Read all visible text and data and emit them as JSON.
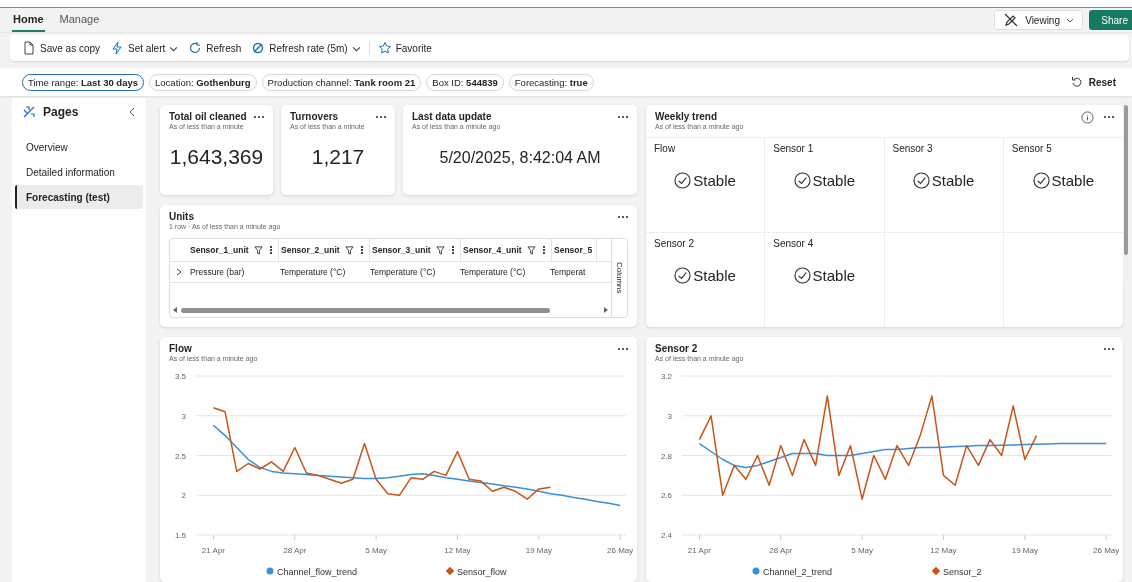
{
  "tabs": [
    {
      "label": "Home",
      "selected": true
    },
    {
      "label": "Manage",
      "selected": false
    }
  ],
  "view_mode": {
    "label": "Viewing"
  },
  "share_button": {
    "label": "Share"
  },
  "toolbar": [
    {
      "label": "Save as copy",
      "kind": "page",
      "dropdown": false,
      "separator_before": false
    },
    {
      "label": "Set alert",
      "kind": "bolt",
      "dropdown": true,
      "separator_before": false
    },
    {
      "label": "Refresh",
      "kind": "refresh",
      "dropdown": false,
      "separator_before": false
    },
    {
      "label": "Refresh rate (5m)",
      "kind": "rate",
      "dropdown": true,
      "separator_before": false
    },
    {
      "label": "Favorite",
      "kind": "star",
      "dropdown": false,
      "separator_before": true
    }
  ],
  "filters": [
    {
      "name": "Time range:",
      "value": "Last 30 days",
      "selected": true
    },
    {
      "name": "Location:",
      "value": "Gothenburg",
      "selected": false
    },
    {
      "name": "Production channel:",
      "value": "Tank room 21",
      "selected": false
    },
    {
      "name": "Box ID:",
      "value": "544839",
      "selected": false
    },
    {
      "name": "Forecasting:",
      "value": "true",
      "selected": false
    }
  ],
  "reset_button": {
    "label": "Reset"
  },
  "sidebar": {
    "title": "Pages",
    "items": [
      {
        "label": "Overview",
        "selected": false
      },
      {
        "label": "Detailed information",
        "selected": false
      },
      {
        "label": "Forecasting (test)",
        "selected": true
      }
    ]
  },
  "kpis": [
    {
      "title": "Total oil cleaned",
      "subtitle": "As of less than a minute",
      "value": "1,643,369"
    },
    {
      "title": "Turnovers",
      "subtitle": "As of less than a minute",
      "value": "1,217"
    },
    {
      "title": "Last data update",
      "subtitle": "As of less than a minute ago",
      "value": "5/20/2025, 8:42:04 AM"
    }
  ],
  "units": {
    "title": "Units",
    "subtitle": "1 row · As of less than a minute ago",
    "columns": [
      "Sensor_1_unit",
      "Sensor_2_unit",
      "Sensor_3_unit",
      "Sensor_4_unit",
      "Sensor_5"
    ],
    "rows": [
      {
        "cells": [
          "Pressure (bar)",
          "Temperature (°C)",
          "Temperature (°C)",
          "Temperature (°C)",
          "Temperat"
        ]
      }
    ],
    "side_panel": "Columns"
  },
  "weekly_trend": {
    "title": "Weekly trend",
    "subtitle": "As of less than a minute ago",
    "tiles": [
      {
        "label": "Flow",
        "status": "Stable",
        "kind": "stable"
      },
      {
        "label": "Sensor 1",
        "status": "Stable",
        "kind": "stable"
      },
      {
        "label": "Sensor 3",
        "status": "Stable",
        "kind": "stable"
      },
      {
        "label": "Sensor 5",
        "status": "Stable",
        "kind": "stable"
      },
      {
        "label": "Sensor 2",
        "status": "Stable",
        "kind": "stable"
      },
      {
        "label": "Sensor 4",
        "status": "Stable",
        "kind": "stable"
      }
    ]
  },
  "charts": [
    {
      "title": "Flow",
      "subtitle": "As of less than a minute ago",
      "chart_data": {
        "type": "line",
        "categories": [
          "21 Apr",
          null,
          null,
          null,
          null,
          null,
          null,
          "28 Apr",
          null,
          null,
          null,
          null,
          null,
          null,
          "5 May",
          null,
          null,
          null,
          null,
          null,
          null,
          "12 May",
          null,
          null,
          null,
          null,
          null,
          null,
          "19 May",
          null,
          null,
          null,
          null,
          null,
          null,
          "26 May"
        ],
        "grid": true,
        "legend": "bottom",
        "ylim": [
          1.5,
          3.5
        ],
        "yticks": [
          1.5,
          2,
          2.5,
          3,
          3.5
        ],
        "series": [
          {
            "name": "Channel_flow_trend",
            "color": "#3a8fd6",
            "values": [
              2.88,
              2.75,
              2.6,
              2.45,
              2.35,
              2.3,
              2.28,
              2.27,
              2.26,
              2.25,
              2.24,
              2.23,
              2.22,
              2.21,
              2.21,
              2.22,
              2.24,
              2.26,
              2.27,
              2.25,
              2.22,
              2.2,
              2.18,
              2.16,
              2.14,
              2.12,
              2.1,
              2.08,
              2.05,
              2.02,
              2.0,
              1.97,
              1.95,
              1.92,
              1.9,
              1.87
            ]
          },
          {
            "name": "Sensor_flow",
            "color": "#c9541a",
            "values": [
              3.1,
              3.05,
              2.3,
              2.4,
              2.33,
              2.42,
              2.3,
              2.6,
              2.28,
              2.25,
              2.2,
              2.15,
              2.2,
              2.65,
              2.2,
              2.02,
              2.0,
              2.22,
              2.2,
              2.3,
              2.25,
              2.55,
              2.2,
              2.18,
              2.05,
              2.1,
              2.05,
              1.95,
              2.08,
              2.1,
              null,
              null,
              null,
              null,
              null,
              null
            ]
          }
        ]
      }
    },
    {
      "title": "Sensor 2",
      "subtitle": "As of less than a minute ago",
      "chart_data": {
        "type": "line",
        "categories": [
          "21 Apr",
          null,
          null,
          null,
          null,
          null,
          null,
          "28 Apr",
          null,
          null,
          null,
          null,
          null,
          null,
          "5 May",
          null,
          null,
          null,
          null,
          null,
          null,
          "12 May",
          null,
          null,
          null,
          null,
          null,
          null,
          "19 May",
          null,
          null,
          null,
          null,
          null,
          null,
          "26 May"
        ],
        "grid": true,
        "legend": "bottom",
        "ylim": [
          2.4,
          3.2
        ],
        "yticks": [
          2.4,
          2.6,
          2.8,
          3,
          3.2
        ],
        "series": [
          {
            "name": "Channel_2_trend",
            "color": "#3a8fd6",
            "values": [
              2.86,
              2.82,
              2.78,
              2.75,
              2.74,
              2.75,
              2.77,
              2.79,
              2.81,
              2.81,
              2.81,
              2.8,
              2.8,
              2.8,
              2.81,
              2.82,
              2.83,
              2.83,
              2.835,
              2.84,
              2.84,
              2.842,
              2.845,
              2.847,
              2.85,
              2.85,
              2.852,
              2.853,
              2.855,
              2.857,
              2.858,
              2.86,
              2.86,
              2.86,
              2.86,
              2.86
            ]
          },
          {
            "name": "Sensor_2",
            "color": "#c9541a",
            "values": [
              2.88,
              3.0,
              2.6,
              2.75,
              2.68,
              2.8,
              2.65,
              2.85,
              2.7,
              2.88,
              2.75,
              3.1,
              2.7,
              2.85,
              2.58,
              2.8,
              2.68,
              2.85,
              2.75,
              2.9,
              3.1,
              2.7,
              2.65,
              2.85,
              2.75,
              2.88,
              2.8,
              3.05,
              2.78,
              2.9,
              null,
              null,
              null,
              null,
              null,
              null
            ]
          }
        ]
      }
    }
  ]
}
